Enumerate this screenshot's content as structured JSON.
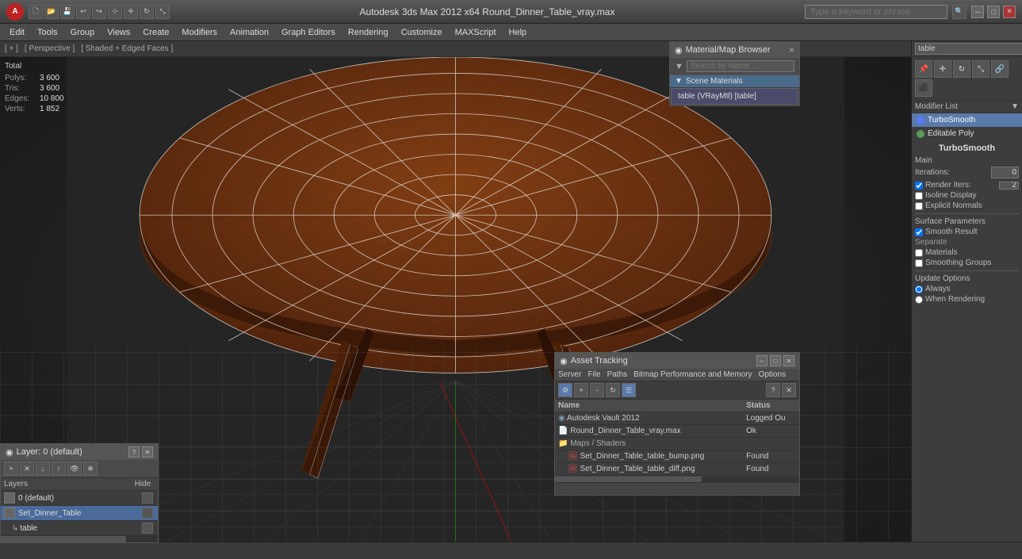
{
  "titlebar": {
    "title": "Autodesk 3ds Max 2012 x64  Round_Dinner_Table_vray.max",
    "search_placeholder": "Type a keyword or phrase",
    "logo_text": "A",
    "toolbar_icons": [
      "new",
      "open",
      "save",
      "undo",
      "redo",
      "select",
      "move",
      "rotate",
      "scale"
    ],
    "win_buttons": [
      "minimize",
      "maximize",
      "close"
    ]
  },
  "menubar": {
    "items": [
      "Edit",
      "Tools",
      "Group",
      "Views",
      "Create",
      "Modifiers",
      "Animation",
      "Graph Editors",
      "Rendering",
      "Customize",
      "MAXScript",
      "Help"
    ]
  },
  "viewinfo": {
    "items": [
      "[ + ]",
      "[ Perspective ]",
      "[ Shaded + Edged Faces ]"
    ]
  },
  "stats": {
    "total_label": "Total",
    "rows": [
      {
        "label": "Polys:",
        "value": "3 600"
      },
      {
        "label": "Tris:",
        "value": "3 600"
      },
      {
        "label": "Edges:",
        "value": "10 800"
      },
      {
        "label": "Verts:",
        "value": "1 852"
      }
    ]
  },
  "material_browser": {
    "title": "Material/Map Browser",
    "search_placeholder": "Search by Name ...",
    "close_label": "×",
    "section_label": "Scene Materials",
    "material_item": "table (VRayMtl) [table]"
  },
  "modifier_panel": {
    "search_value": "table",
    "modifier_list_label": "Modifier List",
    "modifiers": [
      {
        "name": "TurboSmooth",
        "selected": true,
        "color": "blue"
      },
      {
        "name": "Editable Poly",
        "selected": false,
        "color": "green"
      }
    ]
  },
  "right_toolbar_icons": [
    "pin",
    "move-tool",
    "rotate-tool",
    "scale-tool",
    "link",
    "unlink"
  ],
  "turbosmooth": {
    "title": "TurboSmooth",
    "main_label": "Main",
    "iterations_label": "Iterations:",
    "iterations_value": "0",
    "render_iters_label": "Render Iters:",
    "render_iters_value": "2",
    "isoline_display_label": "Isoline Display",
    "explicit_normals_label": "Explicit Normals",
    "surface_params_label": "Surface Parameters",
    "smooth_result_label": "Smooth Result",
    "smooth_result_checked": true,
    "separate_label": "Separate",
    "materials_label": "Materials",
    "smoothing_groups_label": "Smoothing Groups",
    "update_options_label": "Update Options",
    "always_label": "Always",
    "when_rendering_label": "When Rendering"
  },
  "asset_tracking": {
    "title": "Asset Tracking",
    "menu_items": [
      "Server",
      "File",
      "Paths",
      "Bitmap Performance and Memory",
      "Options"
    ],
    "columns": [
      "Name",
      "Status"
    ],
    "rows": [
      {
        "indent": 0,
        "icon": "app",
        "name": "Autodesk Vault 2012",
        "status": "Logged Ou",
        "status_class": "logged"
      },
      {
        "indent": 0,
        "icon": "file",
        "name": "Round_Dinner_Table_vray.max",
        "status": "Ok",
        "status_class": "ok"
      },
      {
        "indent": 0,
        "icon": "folder",
        "name": "Maps / Shaders",
        "status": "",
        "status_class": ""
      },
      {
        "indent": 1,
        "icon": "image",
        "name": "Set_Dinner_Table_table_bump.png",
        "status": "Found",
        "status_class": "found"
      },
      {
        "indent": 1,
        "icon": "image",
        "name": "Set_Dinner_Table_table_diff.png",
        "status": "Found",
        "status_class": "found"
      }
    ]
  },
  "layers": {
    "title": "Layer: 0 (default)",
    "help_label": "?",
    "toolbar_icons": [
      "add-layer",
      "delete-layer",
      "add-selected",
      "remove-selected",
      "hide-all",
      "freeze-all"
    ],
    "columns": {
      "name": "Layers",
      "hide": "Hide"
    },
    "rows": [
      {
        "name": "0 (default)",
        "level": 0,
        "selected": false
      },
      {
        "name": "Set_Dinner_Table",
        "level": 0,
        "selected": true
      },
      {
        "name": "table",
        "level": 1,
        "selected": false
      }
    ]
  },
  "status_bar": {
    "text": ""
  }
}
